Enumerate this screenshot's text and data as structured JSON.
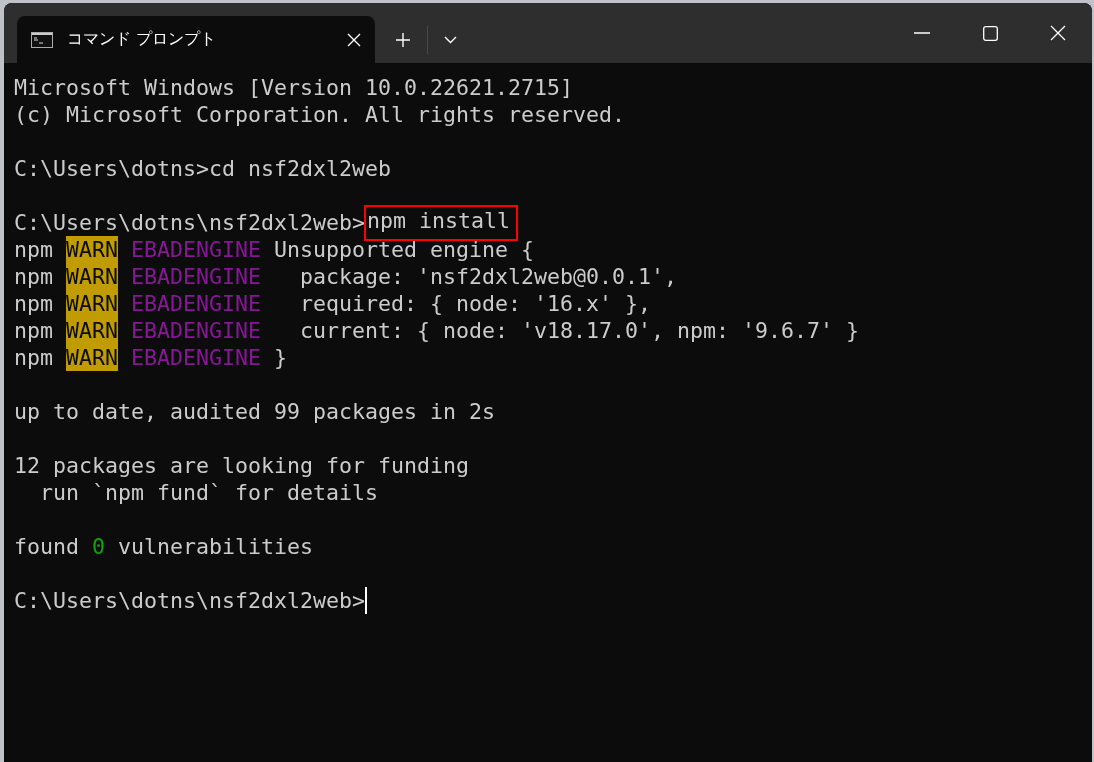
{
  "window": {
    "tab": {
      "title": "コマンド プロンプト",
      "selected": true
    }
  },
  "terminal": {
    "lines": [
      {
        "kind": "text",
        "segments": [
          {
            "kind": "text",
            "text": "Microsoft Windows [Version 10.0.22621.2715]"
          }
        ]
      },
      {
        "kind": "text",
        "segments": [
          {
            "kind": "text",
            "text": "(c) Microsoft Corporation. All rights reserved."
          }
        ]
      },
      {
        "kind": "blank"
      },
      {
        "kind": "text",
        "segments": [
          {
            "kind": "text",
            "text": "C:\\Users\\dotns>cd nsf2dxl2web"
          }
        ]
      },
      {
        "kind": "blank"
      },
      {
        "kind": "text",
        "segments": [
          {
            "kind": "text",
            "text": "C:\\Users\\dotns\\nsf2dxl2web>"
          },
          {
            "kind": "boxed",
            "text": "npm install"
          }
        ]
      },
      {
        "kind": "text",
        "segments": [
          {
            "kind": "text",
            "text": "npm "
          },
          {
            "kind": "warn",
            "text": "WARN"
          },
          {
            "kind": "tag",
            "text": "EBADENGINE"
          },
          {
            "kind": "text",
            "text": " Unsupported engine {"
          }
        ]
      },
      {
        "kind": "text",
        "segments": [
          {
            "kind": "text",
            "text": "npm "
          },
          {
            "kind": "warn",
            "text": "WARN"
          },
          {
            "kind": "tag",
            "text": "EBADENGINE"
          },
          {
            "kind": "text",
            "text": "   package: 'nsf2dxl2web@0.0.1',"
          }
        ]
      },
      {
        "kind": "text",
        "segments": [
          {
            "kind": "text",
            "text": "npm "
          },
          {
            "kind": "warn",
            "text": "WARN"
          },
          {
            "kind": "tag",
            "text": "EBADENGINE"
          },
          {
            "kind": "text",
            "text": "   required: { node: '16.x' },"
          }
        ]
      },
      {
        "kind": "text",
        "segments": [
          {
            "kind": "text",
            "text": "npm "
          },
          {
            "kind": "warn",
            "text": "WARN"
          },
          {
            "kind": "tag",
            "text": "EBADENGINE"
          },
          {
            "kind": "text",
            "text": "   current: { node: 'v18.17.0', npm: '9.6.7' }"
          }
        ]
      },
      {
        "kind": "text",
        "segments": [
          {
            "kind": "text",
            "text": "npm "
          },
          {
            "kind": "warn",
            "text": "WARN"
          },
          {
            "kind": "tag",
            "text": "EBADENGINE"
          },
          {
            "kind": "text",
            "text": " }"
          }
        ]
      },
      {
        "kind": "blank"
      },
      {
        "kind": "text",
        "segments": [
          {
            "kind": "text",
            "text": "up to date, audited 99 packages in 2s"
          }
        ]
      },
      {
        "kind": "blank"
      },
      {
        "kind": "text",
        "segments": [
          {
            "kind": "text",
            "text": "12 packages are looking for funding"
          }
        ]
      },
      {
        "kind": "text",
        "segments": [
          {
            "kind": "text",
            "text": "  run `npm fund` for details"
          }
        ]
      },
      {
        "kind": "blank"
      },
      {
        "kind": "text",
        "segments": [
          {
            "kind": "text",
            "text": "found "
          },
          {
            "kind": "ok",
            "text": "0"
          },
          {
            "kind": "text",
            "text": " vulnerabilities"
          }
        ]
      },
      {
        "kind": "blank"
      },
      {
        "kind": "text",
        "segments": [
          {
            "kind": "text",
            "text": "C:\\Users\\dotns\\nsf2dxl2web>"
          },
          {
            "kind": "cursor"
          }
        ]
      }
    ]
  }
}
